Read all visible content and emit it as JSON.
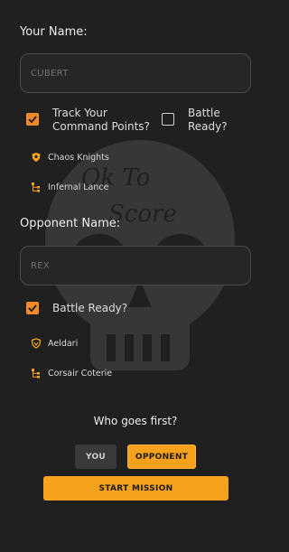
{
  "player": {
    "name_label": "Your Name:",
    "name_placeholder": "CUBERT",
    "track_cp": {
      "label_line1": "Track Your",
      "label_line2": "Command Points?",
      "checked": true
    },
    "battle_ready": {
      "label_line1": "Battle",
      "label_line2": "Ready?",
      "checked": false
    },
    "faction": "Chaos Knights",
    "detachment": "Infernal Lance"
  },
  "opponent": {
    "name_label": "Opponent Name:",
    "name_placeholder": "REX",
    "battle_ready": {
      "label": "Battle Ready?",
      "checked": true
    },
    "faction": "Aeldari",
    "detachment": "Corsair Coterie"
  },
  "turn_order": {
    "question": "Who goes first?",
    "you_label": "YOU",
    "opponent_label": "OPPONENT",
    "selected": "opponent"
  },
  "start_label": "START MISSION",
  "background_text": [
    "Ok To",
    "Score"
  ],
  "colors": {
    "accent": "#f7a21c",
    "checkbox": "#f28a2a",
    "background": "#202020"
  }
}
